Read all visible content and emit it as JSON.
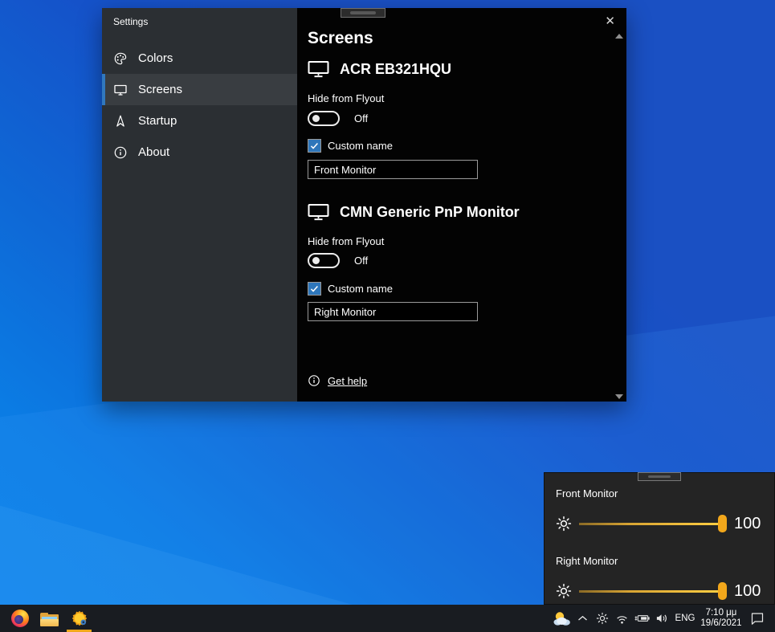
{
  "icons": {
    "close": "✕"
  },
  "colors": {
    "wallpaper_base": "#1552c9",
    "wallpaper_light": "#0b7ce4",
    "sidebar_bg": "#2b2f33",
    "panel_bg": "#030303",
    "accent_blue": "#3178be",
    "checkbox_blue": "#2e76ba",
    "slider_gold": "#ffcf43",
    "slider_thumb": "#f2a71b",
    "taskbar_underline": "#f0a81c"
  },
  "settings_window": {
    "title": "Settings",
    "sidebar_items": [
      {
        "label": "Colors",
        "icon": "palette-icon"
      },
      {
        "label": "Screens",
        "icon": "monitor-icon"
      },
      {
        "label": "Startup",
        "icon": "startup-arrow-icon"
      },
      {
        "label": "About",
        "icon": "info-icon"
      }
    ],
    "page_title": "Screens",
    "monitors": [
      {
        "name": "ACR EB321HQU",
        "hide_label": "Hide from Flyout",
        "toggle_state": "Off",
        "checkbox_label": "Custom name",
        "checkbox_checked": true,
        "custom_name": "Front Monitor"
      },
      {
        "name": "CMN Generic PnP Monitor",
        "hide_label": "Hide from Flyout",
        "toggle_state": "Off",
        "checkbox_label": "Custom name",
        "checkbox_checked": true,
        "custom_name": "Right Monitor"
      }
    ],
    "get_help": "Get help"
  },
  "flyout": {
    "sliders": [
      {
        "label": "Front Monitor",
        "value": "100"
      },
      {
        "label": "Right Monitor",
        "value": "100"
      }
    ]
  },
  "taskbar": {
    "language": "ENG",
    "time": "7:10 μμ",
    "date": "19/6/2021"
  }
}
